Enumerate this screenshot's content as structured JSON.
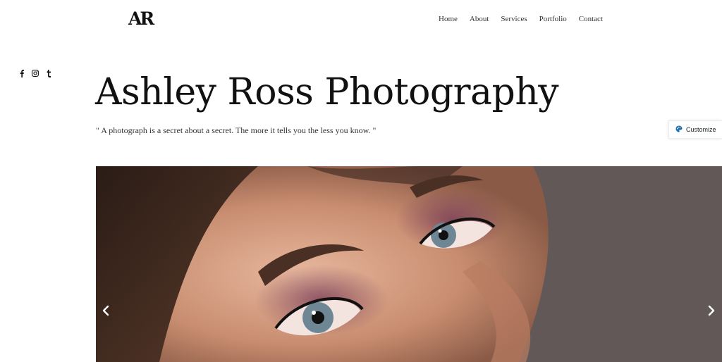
{
  "logo": {
    "text": "AR"
  },
  "nav": {
    "items": [
      "Home",
      "About",
      "Services",
      "Portfolio",
      "Contact"
    ]
  },
  "social": {
    "icons": [
      "facebook-icon",
      "instagram-icon",
      "tumblr-icon"
    ]
  },
  "hero_text": {
    "title": "Ashley Ross Photography",
    "tagline": "\" A photograph is a secret about a secret. The more it tells you the less you know. \""
  },
  "customize": {
    "label": "Customize",
    "icon": "palette-icon",
    "icon_color": "#2271b1"
  },
  "slider": {
    "prev_icon": "chevron-left-icon",
    "next_icon": "chevron-right-icon",
    "image": "close-up portrait photo"
  }
}
